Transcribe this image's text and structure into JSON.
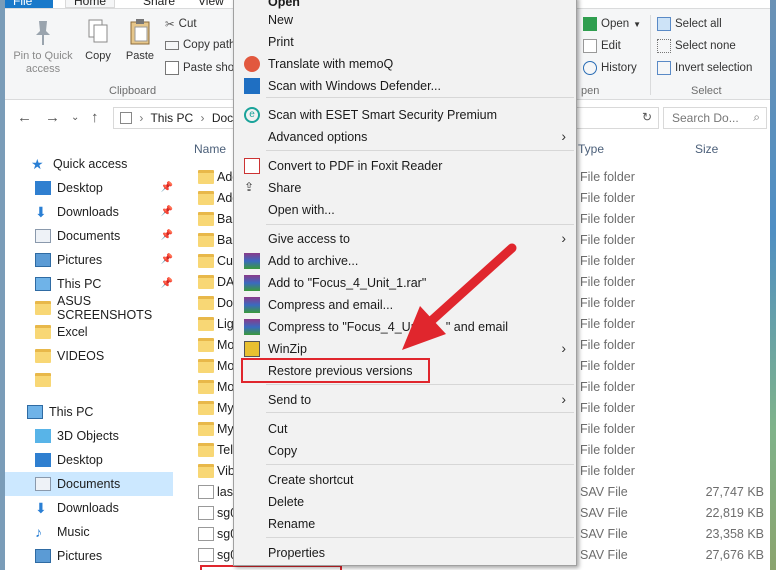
{
  "tabs": {
    "file": "File",
    "home": "Home",
    "share": "Share",
    "view": "View"
  },
  "ribbon": {
    "pin_label": "Pin to Quick access",
    "copy_label": "Copy",
    "paste_label": "Paste",
    "cut_label": "Cut",
    "copy_path_label": "Copy path",
    "paste_shortcut_label": "Paste sho",
    "clipboard_group": "Clipboard",
    "open_label": "Open",
    "edit_label": "Edit",
    "history_label": "History",
    "open_group": "pen",
    "select_all": "Select all",
    "select_none": "Select none",
    "invert_selection": "Invert selection",
    "select_group": "Select"
  },
  "address": {
    "crumb1": "This PC",
    "crumb2": "Doc",
    "search_placeholder": "Search Do..."
  },
  "columns": {
    "name": "Name",
    "type": "Type",
    "size": "Size"
  },
  "sidebar": {
    "items": [
      {
        "label": "Quick access"
      },
      {
        "label": "Desktop"
      },
      {
        "label": "Downloads"
      },
      {
        "label": "Documents"
      },
      {
        "label": "Pictures"
      },
      {
        "label": "This PC"
      },
      {
        "label": "ASUS SCREENSHOTS"
      },
      {
        "label": "Excel"
      },
      {
        "label": "VIDEOS"
      },
      {
        "label": ""
      },
      {
        "label": "This PC"
      },
      {
        "label": "3D Objects"
      },
      {
        "label": "Desktop"
      },
      {
        "label": "Documents"
      },
      {
        "label": "Downloads"
      },
      {
        "label": "Music"
      },
      {
        "label": "Pictures"
      }
    ]
  },
  "files": [
    {
      "name": "Add",
      "type": "File folder",
      "size": ""
    },
    {
      "name": "Add",
      "type": "File folder",
      "size": ""
    },
    {
      "name": "Ban",
      "type": "File folder",
      "size": ""
    },
    {
      "name": "Ban",
      "type": "File folder",
      "size": ""
    },
    {
      "name": "Cus",
      "type": "File folder",
      "size": ""
    },
    {
      "name": "DAV",
      "type": "File folder",
      "size": ""
    },
    {
      "name": "Dov",
      "type": "File folder",
      "size": ""
    },
    {
      "name": "Ligl",
      "type": "File folder",
      "size": ""
    },
    {
      "name": "Mo",
      "type": "File folder",
      "size": ""
    },
    {
      "name": "Mo",
      "type": "File folder",
      "size": ""
    },
    {
      "name": "Mo",
      "type": "File folder",
      "size": ""
    },
    {
      "name": "My",
      "type": "File folder",
      "size": ""
    },
    {
      "name": "My",
      "type": "File folder",
      "size": ""
    },
    {
      "name": "Tell",
      "type": "File folder",
      "size": ""
    },
    {
      "name": "Vib",
      "type": "File folder",
      "size": ""
    },
    {
      "name": "last",
      "type": "SAV File",
      "size": "27,747 KB"
    },
    {
      "name": "sg0",
      "type": "SAV File",
      "size": "22,819 KB"
    },
    {
      "name": "sg0",
      "type": "SAV File",
      "size": "23,358 KB"
    },
    {
      "name": "sg0",
      "type": "SAV File",
      "size": "27,676 KB"
    }
  ],
  "menu": {
    "open": "Open",
    "new": "New",
    "print": "Print",
    "translate": "Translate with memoQ",
    "scan_defender": "Scan with Windows Defender...",
    "scan_eset": "Scan with ESET Smart Security Premium",
    "advanced": "Advanced options",
    "convert_pdf": "Convert to PDF in Foxit Reader",
    "share": "Share",
    "open_with": "Open with...",
    "give_access": "Give access to",
    "add_archive": "Add to archive...",
    "add_rar": "Add to \"Focus_4_Unit_1.rar\"",
    "compress_email": "Compress and email...",
    "compress_to_a": "Compress to \"Focus_4_Unit",
    "compress_to_b": "\" and email",
    "winzip": "WinZip",
    "restore": "Restore previous versions",
    "send_to": "Send to",
    "cut": "Cut",
    "copy": "Copy",
    "create_shortcut": "Create shortcut",
    "delete": "Delete",
    "rename": "Rename",
    "properties": "Properties"
  },
  "colors": {
    "highlight": "#e0262d",
    "file_tab": "#1979ca",
    "selection": "#cce8ff"
  }
}
